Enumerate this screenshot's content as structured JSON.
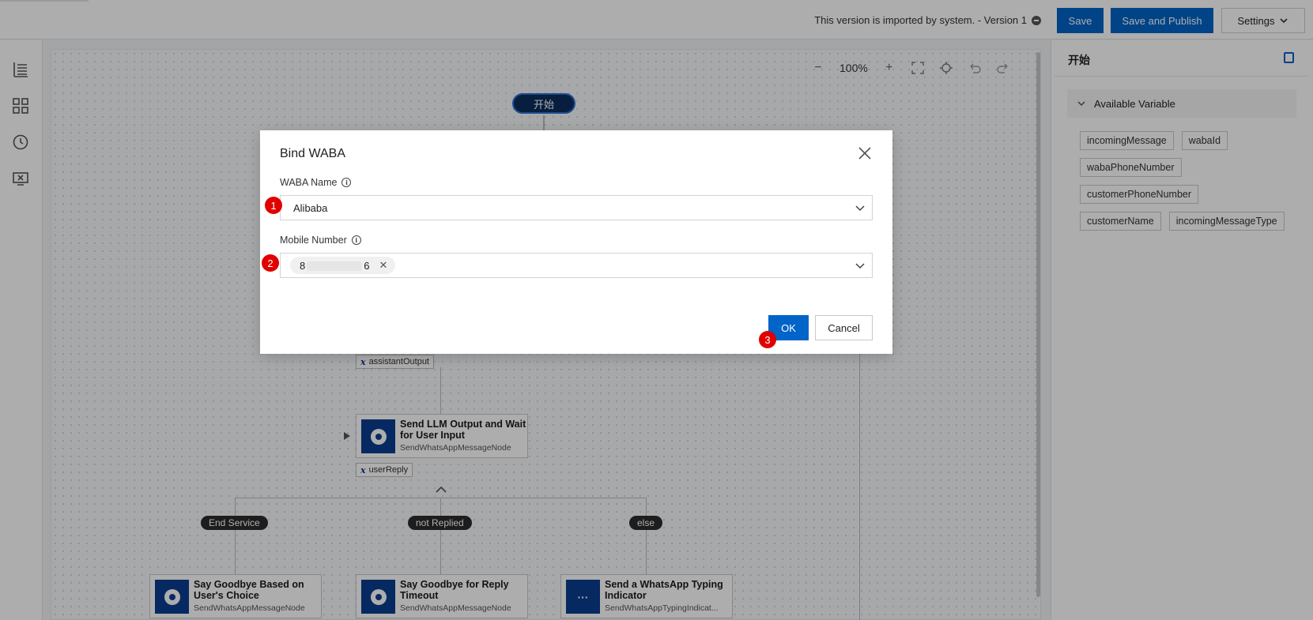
{
  "topbar": {
    "version_text": "This version is imported by system. - Version 1",
    "save_label": "Save",
    "publish_label": "Save and Publish",
    "settings_label": "Settings"
  },
  "canvas": {
    "zoom": "100%",
    "start_label": "开始",
    "tags": {
      "assistant_output": "assistantOutput",
      "user_reply": "userReply"
    },
    "node_main": {
      "title": "Send LLM Output and Wait for User Input",
      "subtitle": "SendWhatsAppMessageNode"
    },
    "branches": [
      "End Service",
      "not Replied",
      "else"
    ],
    "bottom_nodes": [
      {
        "title": "Say Goodbye Based on User's Choice",
        "subtitle": "SendWhatsAppMessageNode"
      },
      {
        "title": "Say Goodbye for Reply Timeout",
        "subtitle": "SendWhatsAppMessageNode"
      },
      {
        "title": "Send a WhatsApp Typing Indicator",
        "subtitle": "SendWhatsAppTypingIndicat..."
      }
    ]
  },
  "right_panel": {
    "title": "开始",
    "section": "Available Variable",
    "variables": [
      "incomingMessage",
      "wabaId",
      "wabaPhoneNumber",
      "customerPhoneNumber",
      "customerName",
      "incomingMessageType"
    ]
  },
  "modal": {
    "title": "Bind WABA",
    "waba_label": "WABA Name",
    "waba_value": "Alibaba",
    "mobile_label": "Mobile Number",
    "mobile_prefix": "8",
    "mobile_suffix": "6",
    "ok_label": "OK",
    "cancel_label": "Cancel",
    "badges": [
      "1",
      "2",
      "3"
    ]
  },
  "colors": {
    "primary": "#0064c8",
    "node_icon": "#0b3d91",
    "badge": "#e00000"
  }
}
